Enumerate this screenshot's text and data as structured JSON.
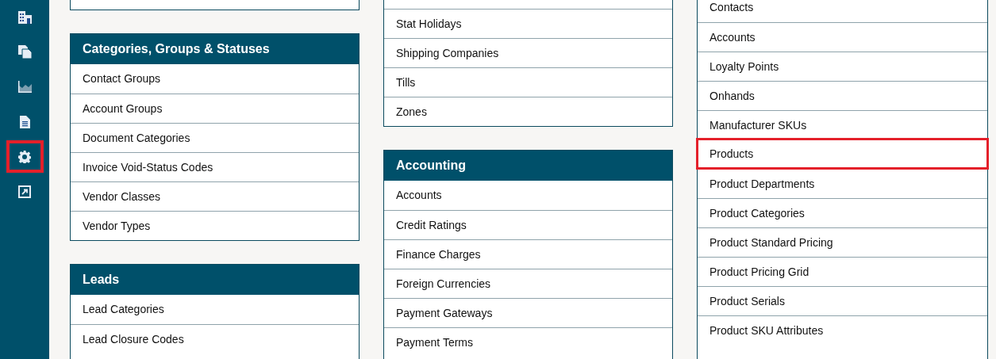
{
  "sidebar": {
    "items": [
      {
        "kind": "building",
        "selected": false
      },
      {
        "kind": "copy",
        "selected": false
      },
      {
        "kind": "chart",
        "selected": false
      },
      {
        "kind": "document",
        "selected": false
      },
      {
        "kind": "settings",
        "selected": true
      },
      {
        "kind": "external",
        "selected": false
      }
    ]
  },
  "columns": [
    {
      "cards": [
        {
          "title": "Categories, Groups & Statuses",
          "items": [
            {
              "label": "Contact Groups",
              "highlighted": false
            },
            {
              "label": "Account Groups",
              "highlighted": false
            },
            {
              "label": "Document Categories",
              "highlighted": false
            },
            {
              "label": "Invoice Void-Status Codes",
              "highlighted": false
            },
            {
              "label": "Vendor Classes",
              "highlighted": false
            },
            {
              "label": "Vendor Types",
              "highlighted": false
            }
          ]
        },
        {
          "title": "Leads",
          "items": [
            {
              "label": "Lead Categories",
              "highlighted": false
            },
            {
              "label": "Lead Closure Codes",
              "highlighted": false
            }
          ]
        }
      ]
    },
    {
      "cards": [
        {
          "items": [
            {
              "label": "Stat Holidays",
              "highlighted": false
            },
            {
              "label": "Shipping Companies",
              "highlighted": false
            },
            {
              "label": "Tills",
              "highlighted": false
            },
            {
              "label": "Zones",
              "highlighted": false
            }
          ]
        },
        {
          "title": "Accounting",
          "items": [
            {
              "label": "Accounts",
              "highlighted": false
            },
            {
              "label": "Credit Ratings",
              "highlighted": false
            },
            {
              "label": "Finance Charges",
              "highlighted": false
            },
            {
              "label": "Foreign Currencies",
              "highlighted": false
            },
            {
              "label": "Payment Gateways",
              "highlighted": false
            },
            {
              "label": "Payment Terms",
              "highlighted": false
            }
          ]
        }
      ]
    },
    {
      "cards": [
        {
          "items": [
            {
              "label": "Contacts",
              "highlighted": false
            },
            {
              "label": "Accounts",
              "highlighted": false
            },
            {
              "label": "Loyalty Points",
              "highlighted": false
            },
            {
              "label": "Onhands",
              "highlighted": false
            },
            {
              "label": "Manufacturer SKUs",
              "highlighted": false
            },
            {
              "label": "Products",
              "highlighted": true
            },
            {
              "label": "Product Departments",
              "highlighted": false
            },
            {
              "label": "Product Categories",
              "highlighted": false
            },
            {
              "label": "Product Standard Pricing",
              "highlighted": false
            },
            {
              "label": "Product Pricing Grid",
              "highlighted": false
            },
            {
              "label": "Product Serials",
              "highlighted": false
            },
            {
              "label": "Product SKU Attributes",
              "highlighted": false
            }
          ]
        }
      ]
    }
  ]
}
